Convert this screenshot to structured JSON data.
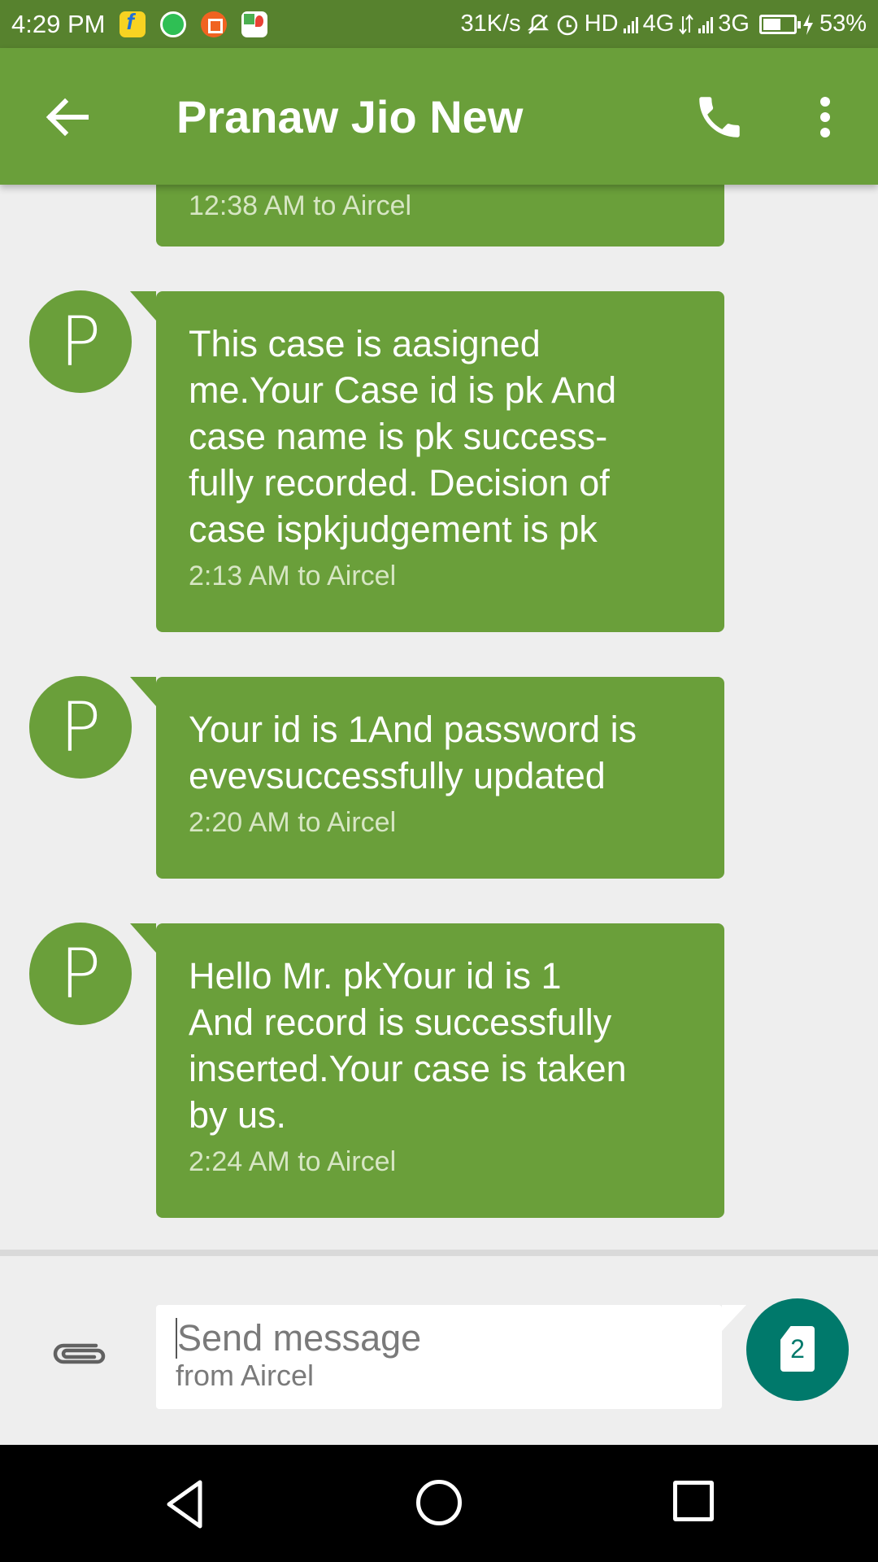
{
  "status_bar": {
    "time": "4:29 PM",
    "speed": "31K/s",
    "network_text": "HD",
    "net_4g": "4G",
    "net_3g": "3G",
    "battery": "53%",
    "app_icons": [
      "flipkart-icon",
      "whatsapp-icon",
      "crop-icon",
      "maps-icon"
    ]
  },
  "app_bar": {
    "title": "Pranaw Jio New",
    "icons": [
      "back-arrow-icon",
      "phone-icon",
      "more-vert-icon"
    ]
  },
  "messages": [
    {
      "text": "",
      "meta": "12:38 AM to Aircel",
      "avatar": ""
    },
    {
      "text": "This case is aasigned\nme.Your Case id is pk And\ncase name is pk success-\nfully recorded. Decision of\ncase ispkjudgement is pk",
      "meta": "2:13 AM to Aircel",
      "avatar": "P"
    },
    {
      "text": "Your id is 1And password is\nevevsuccessfully updated",
      "meta": "2:20 AM to Aircel",
      "avatar": "P"
    },
    {
      "text": "Hello Mr. pkYour id is 1\nAnd  record is successfully\ninserted.Your case is taken\nby us.",
      "meta": "2:24 AM to Aircel",
      "avatar": "P"
    }
  ],
  "composer": {
    "placeholder": "Send message",
    "sub": "from Aircel",
    "sim_number": "2"
  },
  "colors": {
    "status_bar": "#57822e",
    "primary": "#6a9f3a",
    "send_button": "#00796b",
    "background": "#eeeeee"
  }
}
